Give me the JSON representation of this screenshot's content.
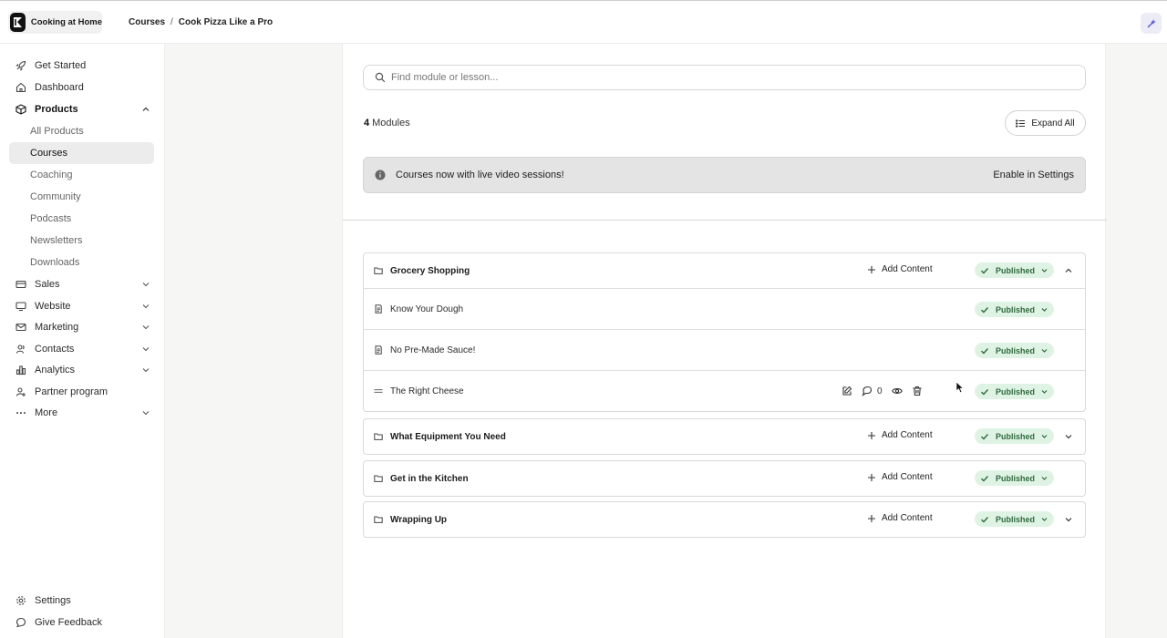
{
  "header": {
    "brand_name": "Cooking at Home",
    "breadcrumb": [
      "Courses",
      "Cook Pizza Like a Pro"
    ],
    "breadcrumb_separator": "/"
  },
  "sidebar": {
    "items": [
      {
        "label": "Get Started",
        "icon": "rocket-icon"
      },
      {
        "label": "Dashboard",
        "icon": "home-icon"
      },
      {
        "label": "Products",
        "icon": "box-icon",
        "expanded": true
      },
      {
        "label": "Sales",
        "icon": "credit-card-icon"
      },
      {
        "label": "Website",
        "icon": "monitor-icon"
      },
      {
        "label": "Marketing",
        "icon": "mail-icon"
      },
      {
        "label": "Contacts",
        "icon": "users-icon"
      },
      {
        "label": "Analytics",
        "icon": "bar-chart-icon"
      },
      {
        "label": "Partner program",
        "icon": "partner-icon"
      },
      {
        "label": "More",
        "icon": "dots-icon"
      }
    ],
    "products_sub": [
      "All Products",
      "Courses",
      "Coaching",
      "Community",
      "Podcasts",
      "Newsletters",
      "Downloads"
    ],
    "active_sub": "Courses",
    "footer": [
      {
        "label": "Settings",
        "icon": "gear-icon"
      },
      {
        "label": "Give Feedback",
        "icon": "chat-bubble-icon"
      }
    ]
  },
  "main": {
    "search_placeholder": "Find module or lesson...",
    "module_count": "4",
    "module_count_label": "Modules",
    "expand_all_label": "Expand All",
    "banner_message": "Courses now with live video sessions!",
    "banner_link": "Enable in Settings",
    "add_content_label": "Add Content",
    "status_label": "Published",
    "modules": [
      {
        "title": "Grocery Shopping",
        "expanded": true,
        "lessons": [
          {
            "title": "Know Your Dough"
          },
          {
            "title": "No Pre-Made Sauce!"
          },
          {
            "title": "The Right Cheese",
            "hovered": true,
            "comment_count": "0"
          }
        ]
      },
      {
        "title": "What Equipment You Need",
        "expanded": false
      },
      {
        "title": "Get in the Kitchen",
        "expanded": false
      },
      {
        "title": "Wrapping Up",
        "expanded": false
      }
    ]
  },
  "colors": {
    "status_bg": "#dff3e4",
    "status_text": "#2f6a3e",
    "accent": "#5b5bd6"
  }
}
